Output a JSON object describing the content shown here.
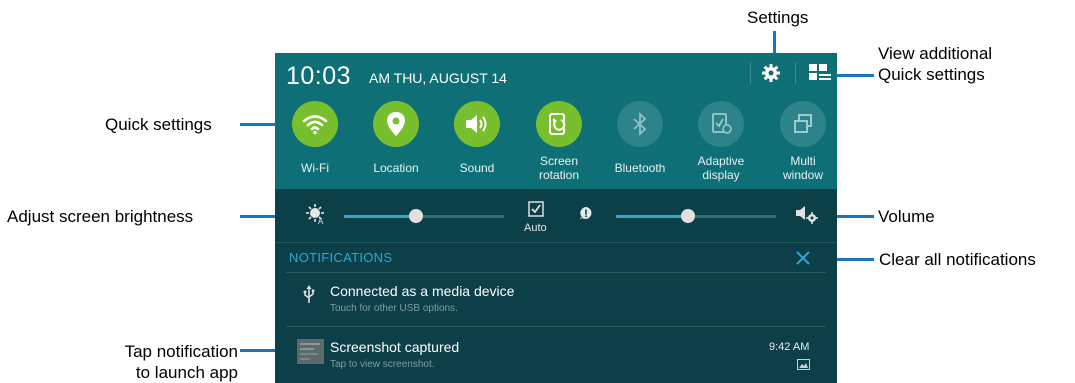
{
  "callouts": {
    "settings": "Settings",
    "view_additional_1": "View additional",
    "view_additional_2": "Quick settings",
    "quick_settings": "Quick settings",
    "adjust_brightness": "Adjust screen brightness",
    "volume": "Volume",
    "clear_all": "Clear all notifications",
    "tap_notification_1": "Tap notification",
    "tap_notification_2": "to launch app"
  },
  "status": {
    "time": "10:03",
    "date": "AM THU, AUGUST 14"
  },
  "tiles": [
    {
      "label_1": "Wi-Fi",
      "label_2": "",
      "icon": "wifi-icon",
      "state": "on"
    },
    {
      "label_1": "Location",
      "label_2": "",
      "icon": "location-icon",
      "state": "on"
    },
    {
      "label_1": "Sound",
      "label_2": "",
      "icon": "sound-icon",
      "state": "on"
    },
    {
      "label_1": "Screen",
      "label_2": "rotation",
      "icon": "screen-rotation-icon",
      "state": "on"
    },
    {
      "label_1": "Bluetooth",
      "label_2": "",
      "icon": "bluetooth-icon",
      "state": "off"
    },
    {
      "label_1": "Adaptive",
      "label_2": "display",
      "icon": "adaptive-display-icon",
      "state": "off"
    },
    {
      "label_1": "Multi",
      "label_2": "window",
      "icon": "multi-window-icon",
      "state": "off"
    }
  ],
  "brightness": {
    "auto_label": "Auto",
    "auto_checked": true,
    "brightness_level": 0.45,
    "volume_level": 0.45
  },
  "notifications": {
    "header": "NOTIFICATIONS",
    "items": [
      {
        "title": "Connected as a media device",
        "subtitle": "Touch for other USB options.",
        "time": ""
      },
      {
        "title": "Screenshot captured",
        "subtitle": "Tap to view screenshot.",
        "time": "9:42 AM"
      }
    ]
  },
  "colors": {
    "accent_line": "#1b75bb",
    "tile_on": "#78bf2e",
    "tile_off": "#2c838a",
    "panel_top": "#0f6f76",
    "panel_body": "#0c3f48",
    "notif_header": "#2fa7d6"
  }
}
